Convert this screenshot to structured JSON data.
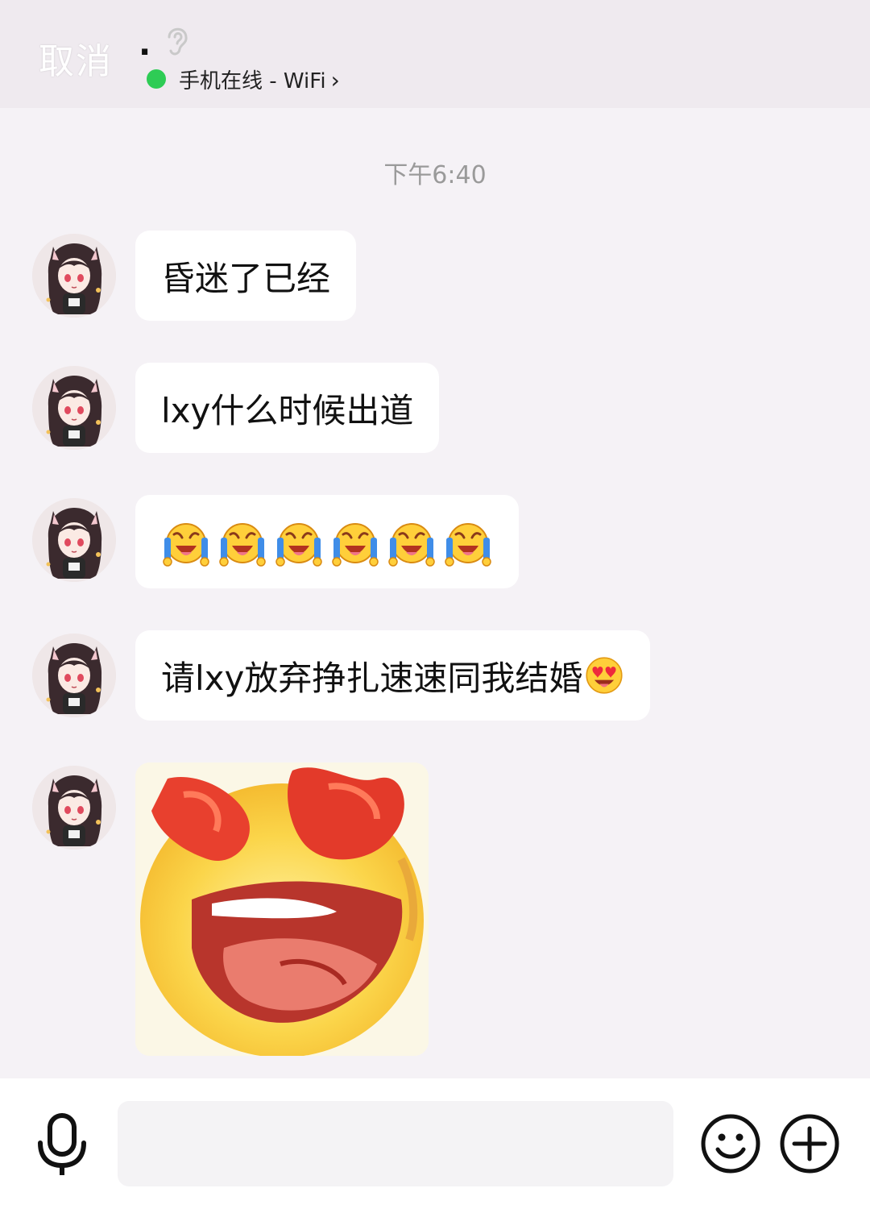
{
  "header": {
    "cancel_label": "取消",
    "contact_name": ".",
    "status_text": "手机在线 - WiFi",
    "status_chevron": "›",
    "online_color": "#2ecc55"
  },
  "timestamp": "下午6:40",
  "messages": [
    {
      "type": "text",
      "text": "昏迷了已经"
    },
    {
      "type": "text",
      "text": "lxy什么时候出道"
    },
    {
      "type": "emoji_row",
      "emoji": "laugh-cry-emoji",
      "count": 6
    },
    {
      "type": "text",
      "text": "请lxy放弃挣扎速速同我结婚",
      "trailing_emoji": "heart-eyes-emoji"
    },
    {
      "type": "sticker",
      "sticker": "heart-eyes-drool-sticker"
    }
  ],
  "input_bar": {
    "placeholder": "",
    "mic_icon": "microphone-icon",
    "emoji_icon": "smiley-icon",
    "plus_icon": "plus-icon"
  }
}
